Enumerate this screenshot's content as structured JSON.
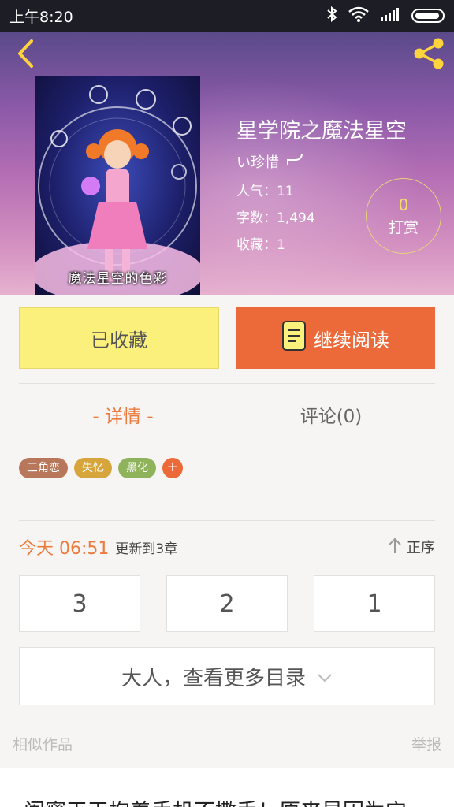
{
  "status_bar": {
    "time": "上午8:20"
  },
  "book": {
    "title": "星学院之魔法星空",
    "author": "い珍惜",
    "cover_caption": "魔法星空的色彩",
    "popularity": "人气：11",
    "word_count": "字数：1,494",
    "favorites": "收藏：1"
  },
  "tip": {
    "count": "0",
    "label": "打赏"
  },
  "actions": {
    "collected_label": "已收藏",
    "continue_label": "继续阅读"
  },
  "tabs": {
    "detail": "- 详情 -",
    "comments": "评论(0)"
  },
  "tags": [
    {
      "label": "三角恋",
      "color": "#b8775a"
    },
    {
      "label": "失忆",
      "color": "#d6a53c"
    },
    {
      "label": "黑化",
      "color": "#8fb35b"
    }
  ],
  "tag_add": "+",
  "update": {
    "time": "今天 06:51",
    "text": "更新到3章",
    "sort_label": "正序"
  },
  "chapters": [
    "3",
    "2",
    "1"
  ],
  "more_catalog": "大人，查看更多目录",
  "similar": {
    "label": "相似作品",
    "report": "举报",
    "first_item": "闺蜜天天抱着手机不撒手！原来是因为它~"
  },
  "colors": {
    "accent_orange": "#ec6a39",
    "collected_yellow": "#fcf07c",
    "tip_gold": "#f6e06a"
  },
  "icons": [
    "back-icon",
    "share-icon",
    "book-icon",
    "arrow-up-icon",
    "chevron-down-icon",
    "bluetooth-icon",
    "wifi-icon",
    "signal-icon",
    "battery-icon"
  ]
}
